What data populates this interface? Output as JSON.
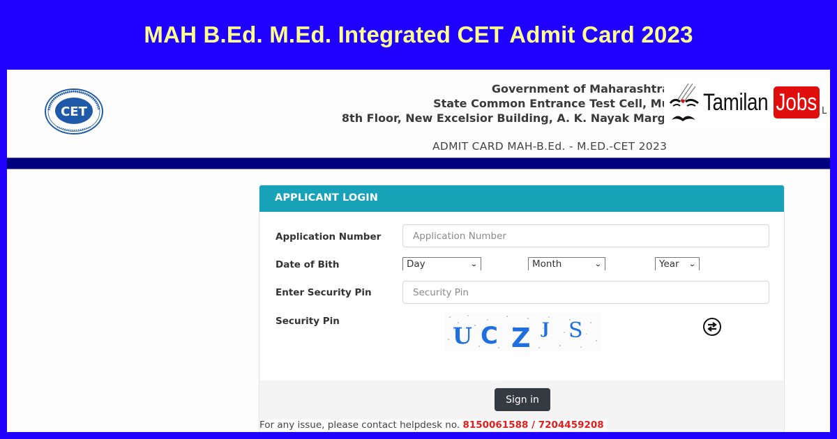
{
  "banner": {
    "title": "MAH B.Ed. M.Ed. Integrated CET Admit Card 2023",
    "background_color": "#1f00ff",
    "title_color": "#ffff8c"
  },
  "header": {
    "logo": {
      "icon": "cet-logo-icon",
      "center_text": "CET",
      "ring_text_top": "STATE COMMON ENTRANCE TEST CELL",
      "ring_text_bottom": "MAHARASHTRA"
    },
    "lines": [
      "Government of Maharashtra",
      "State Common Entrance Test Cell, Mu",
      "8th Floor, New Excelsior Building, A. K. Nayak Marg,"
    ],
    "admit_card_title": "ADMIT CARD MAH-B.Ed. - M.ED.-CET 2023"
  },
  "watermark": {
    "icon": "tamilan-face-icon",
    "text_1": "Tamilan",
    "text_2": "Jobs",
    "trailing": "L",
    "accent_color": "#e00d0d"
  },
  "login_panel": {
    "heading": "APPLICANT LOGIN",
    "heading_color": "#17a2b8",
    "application_number": {
      "label": "Application Number",
      "value": "",
      "placeholder": "Application Number"
    },
    "date_of_birth": {
      "label": "Date of Bith",
      "day": "Day",
      "month": "Month",
      "year": "Year"
    },
    "security_pin_input": {
      "label": "Enter Security Pin",
      "value": "",
      "placeholder": "Security Pin"
    },
    "captcha": {
      "label": "Security Pin",
      "characters": [
        "U",
        "C",
        "Z",
        "J",
        "S"
      ],
      "refresh_icon": "refresh-icon"
    },
    "sign_in_label": "Sign in"
  },
  "helpdesk": {
    "text": "For any issue, please contact helpdesk no.",
    "numbers": "8150061588 / 7204459208",
    "number_color": "#e11d1d"
  }
}
